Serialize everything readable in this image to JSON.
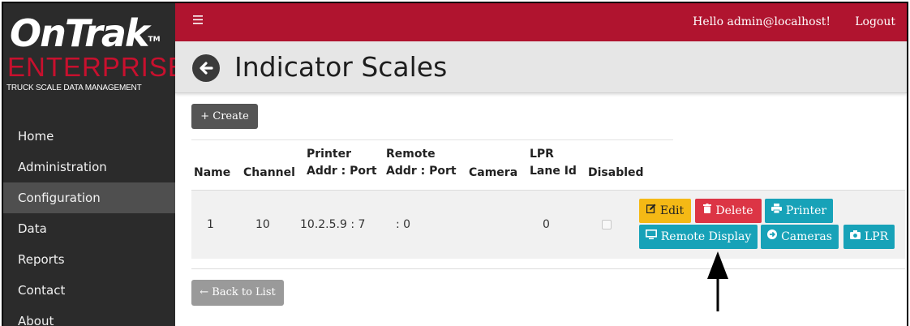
{
  "brand": {
    "logo_top": "OnTrak",
    "logo_tm": "TM",
    "logo_mid": "ENTERPRISE",
    "logo_sub": "TRUCK SCALE DATA MANAGEMENT"
  },
  "nav": {
    "items": [
      "Home",
      "Administration",
      "Configuration",
      "Data",
      "Reports",
      "Contact",
      "About"
    ],
    "active": "Configuration"
  },
  "topbar": {
    "menu_icon": "hamburger-icon",
    "greeting": "Hello admin@localhost!",
    "logout": "Logout"
  },
  "page": {
    "title": "Indicator Scales",
    "create_label": "+ Create",
    "back_label": "← Back to List"
  },
  "table": {
    "headers": {
      "name": "Name",
      "channel": "Channel",
      "printer_1": "Printer",
      "printer_2": "Addr : Port",
      "remote_1": "Remote",
      "remote_2": "Addr : Port",
      "camera": "Camera",
      "lpr_1": "LPR",
      "lpr_2": "Lane Id",
      "disabled": "Disabled"
    },
    "row": {
      "name": "1",
      "channel": "10",
      "printer": "10.2.5.9 : 7",
      "remote": ": 0",
      "camera": "",
      "lpr": "0",
      "disabled": false
    }
  },
  "actions": {
    "edit": "Edit",
    "delete": "Delete",
    "printer": "Printer",
    "remote_display": "Remote Display",
    "cameras": "Cameras",
    "lpr": "LPR"
  },
  "colors": {
    "topbar": "#b0142f",
    "sidebar": "#2b2b2b",
    "warning": "#f5b915",
    "danger": "#dc3545",
    "info": "#17a2b8"
  }
}
